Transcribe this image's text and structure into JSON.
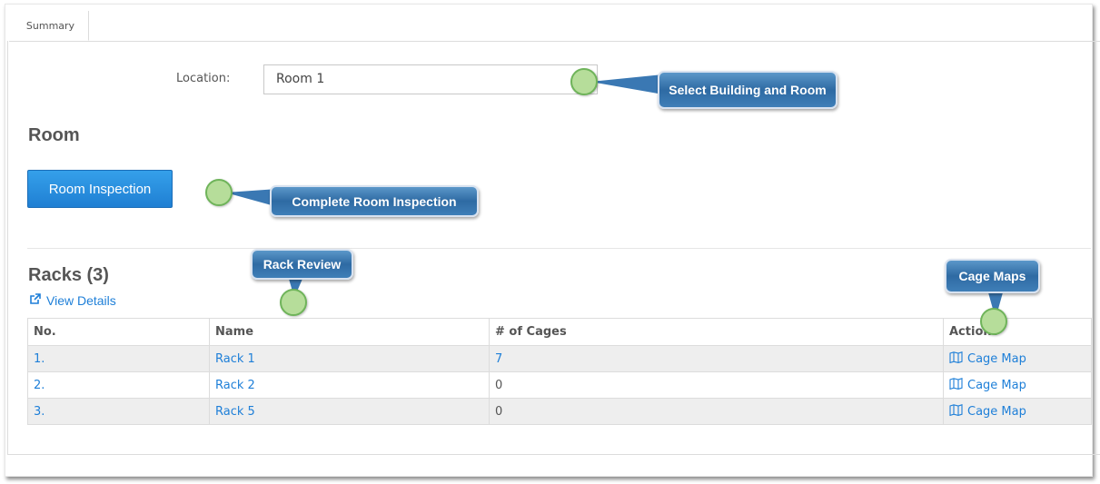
{
  "tabs": [
    {
      "label": "Summary",
      "active": true
    }
  ],
  "location": {
    "label": "Location:",
    "value": "Room 1"
  },
  "room": {
    "heading": "Room",
    "inspection_button": "Room Inspection"
  },
  "racks": {
    "heading": "Racks (3)",
    "view_details": "View Details",
    "columns": [
      "No.",
      "Name",
      "# of Cages",
      "Actions"
    ],
    "rows": [
      {
        "no": "1.",
        "name": "Rack 1",
        "cages": "7",
        "action": "Cage Map"
      },
      {
        "no": "2.",
        "name": "Rack 2",
        "cages": "0",
        "action": "Cage Map"
      },
      {
        "no": "3.",
        "name": "Rack 5",
        "cages": "0",
        "action": "Cage Map"
      }
    ]
  },
  "callouts": {
    "location": "Select Building and Room",
    "inspection": "Complete Room Inspection",
    "rack_review": "Rack Review",
    "cage_maps": "Cage Maps"
  },
  "colors": {
    "link": "#1e7fd8",
    "button": "#2a8ee0",
    "callout": "#2e6aa3",
    "marker": "#b6dd9a"
  }
}
